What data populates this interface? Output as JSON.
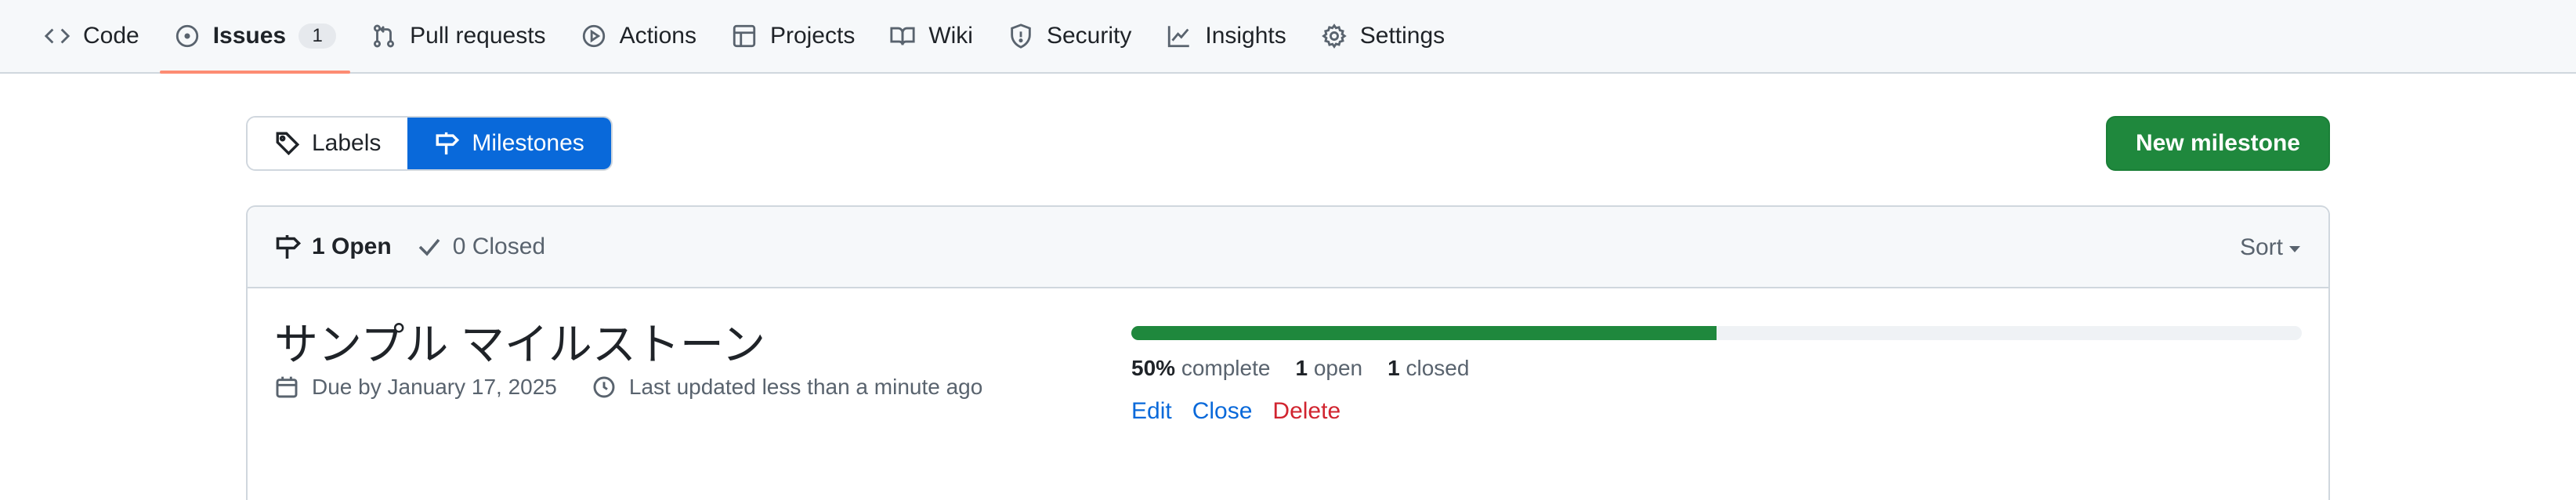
{
  "nav": {
    "items": [
      {
        "label": "Code",
        "icon": "code-icon"
      },
      {
        "label": "Issues",
        "icon": "issue-opened-icon",
        "counter": "1",
        "selected": true
      },
      {
        "label": "Pull requests",
        "icon": "git-pull-request-icon"
      },
      {
        "label": "Actions",
        "icon": "play-icon"
      },
      {
        "label": "Projects",
        "icon": "table-icon"
      },
      {
        "label": "Wiki",
        "icon": "book-icon"
      },
      {
        "label": "Security",
        "icon": "shield-icon"
      },
      {
        "label": "Insights",
        "icon": "graph-icon"
      },
      {
        "label": "Settings",
        "icon": "gear-icon"
      }
    ]
  },
  "subnav": {
    "labels": "Labels",
    "milestones": "Milestones",
    "new_milestone": "New milestone"
  },
  "filters": {
    "open": "1 Open",
    "closed": "0 Closed",
    "sort": "Sort"
  },
  "milestone": {
    "title": "サンプル マイルストーン",
    "due": "Due by January 17, 2025",
    "updated": "Last updated less than a minute ago",
    "progress_fraction": 0.5,
    "percent": "50%",
    "percent_suffix": "complete",
    "open_count": "1",
    "open_label": "open",
    "closed_count": "1",
    "closed_label": "closed",
    "actions": {
      "edit": "Edit",
      "close": "Close",
      "delete": "Delete"
    }
  },
  "colors": {
    "accent": "#0969da",
    "primary_button": "#1f883d",
    "danger": "#d1242f",
    "selected_underline": "#fd8c73"
  }
}
